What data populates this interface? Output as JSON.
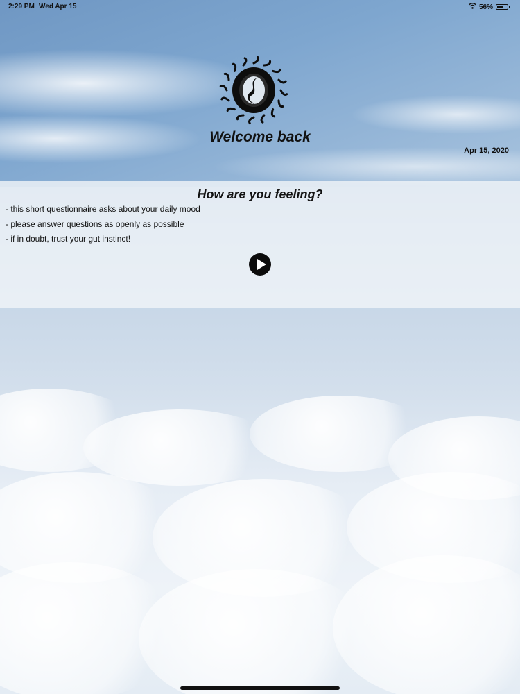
{
  "status_bar": {
    "time": "2:29 PM",
    "date": "Wed Apr 15",
    "battery_percent_text": "56%",
    "battery_level": 0.56,
    "wifi_icon": "wifi-icon"
  },
  "header": {
    "logo_icon": "sun-logo-icon",
    "welcome_text": "Welcome back",
    "date_text": "Apr 15, 2020"
  },
  "questionnaire": {
    "title": "How are you feeling?",
    "lines": [
      "- this short questionnaire asks about your daily mood",
      "- please answer questions as openly as possible",
      "- if in doubt, trust your gut instinct!"
    ],
    "start_icon": "play-icon"
  },
  "colors": {
    "accent": "#0b0b0b",
    "panel": "#f0f4f8"
  }
}
